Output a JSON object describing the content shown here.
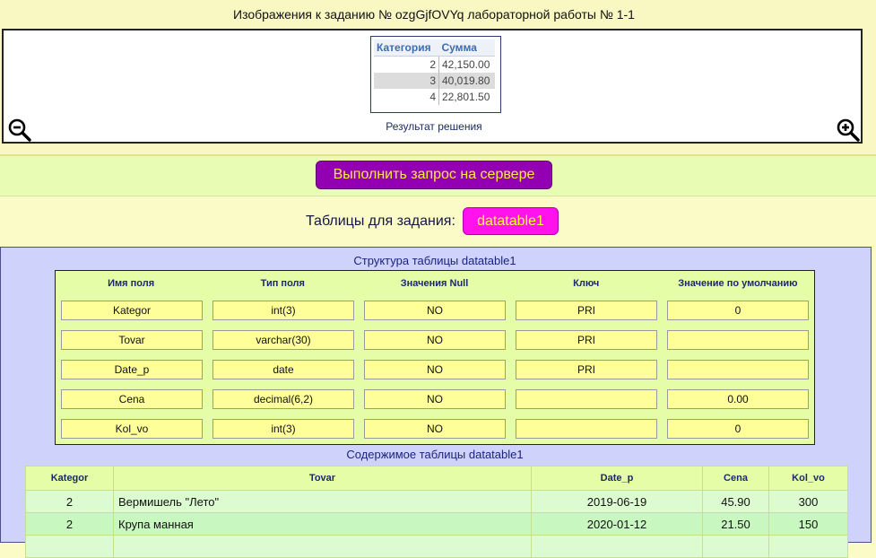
{
  "header": {
    "title": "Изображения к заданию № ozgGjfOVYq лабораторной работы № 1-1"
  },
  "result_image": {
    "columns": [
      "Категория",
      "Сумма"
    ],
    "rows": [
      {
        "c1": "2",
        "c2": "42,150.00"
      },
      {
        "c1": "3",
        "c2": "40,019.80"
      },
      {
        "c1": "4",
        "c2": "22,801.50"
      }
    ],
    "caption": "Результат решения",
    "zoom_out_icon": "zoom-out-icon",
    "zoom_in_icon": "zoom-in-icon"
  },
  "run_button": {
    "label": "Выполнить запрос на сервере",
    "color": "#9300b4"
  },
  "tables": {
    "label": "Таблицы для задания:",
    "button": "datatable1",
    "color": "#ff12ee"
  },
  "structure": {
    "title": "Структура таблицы datatable1",
    "headers": [
      "Имя поля",
      "Тип поля",
      "Значения Null",
      "Ключ",
      "Значение по умолчанию"
    ],
    "rows": [
      [
        "Kategor",
        "int(3)",
        "NO",
        "PRI",
        "0"
      ],
      [
        "Tovar",
        "varchar(30)",
        "NO",
        "PRI",
        ""
      ],
      [
        "Date_p",
        "date",
        "NO",
        "PRI",
        ""
      ],
      [
        "Cena",
        "decimal(6,2)",
        "NO",
        "",
        "0.00"
      ],
      [
        "Kol_vo",
        "int(3)",
        "NO",
        "",
        "0"
      ]
    ]
  },
  "content": {
    "title": "Содержимое таблицы datatable1",
    "headers": [
      "Kategor",
      "Tovar",
      "Date_p",
      "Cena",
      "Kol_vo"
    ],
    "rows": [
      [
        "2",
        "Вермишель \"Лето\"",
        "2019-06-19",
        "45.90",
        "300"
      ],
      [
        "2",
        "Крупа манная",
        "2020-01-12",
        "21.50",
        "150"
      ]
    ]
  }
}
